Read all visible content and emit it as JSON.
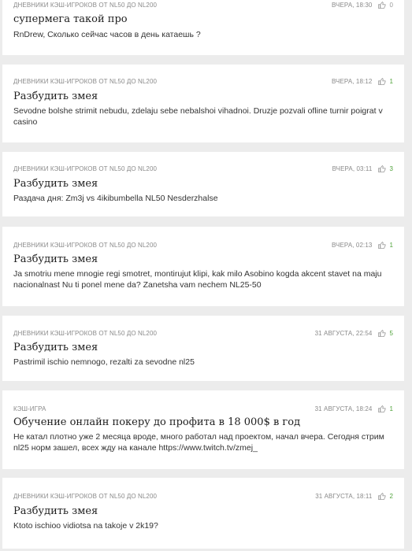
{
  "feed": {
    "posts": [
      {
        "category": "Дневники кэш-игроков от NL50 до NL200",
        "date": "Вчера, 18:30",
        "likes": "0",
        "title": "супермега такой про",
        "excerpt": "RnDrew, Сколько сейчас часов в день катаешь ?"
      },
      {
        "category": "Дневники кэш-игроков от NL50 до NL200",
        "date": "Вчера, 18:12",
        "likes": "1",
        "title": "Разбудить змея",
        "excerpt": "Sevodne bolshe strimit nebudu, zdelaju sebe nebalshoi vihadnoi. Druzje pozvali ofline turnir poigrat v casino"
      },
      {
        "category": "Дневники кэш-игроков от NL50 до NL200",
        "date": "Вчера, 03:11",
        "likes": "3",
        "title": "Разбудить змея",
        "excerpt": "Раздача дня: Zm3j vs 4ikibumbella NL50 Nesderzhalse"
      },
      {
        "category": "Дневники кэш-игроков от NL50 до NL200",
        "date": "Вчера, 02:13",
        "likes": "1",
        "title": "Разбудить змея",
        "excerpt": "Ja smotriu mene mnogie regi smotret, montirujut klipi, kak milo Asobino kogda akcent stavet na maju nacionalnast Nu ti ponel mene da? Zanetsha vam nechem NL25-50"
      },
      {
        "category": "Дневники кэш-игроков от NL50 до NL200",
        "date": "31 августа, 22:54",
        "likes": "5",
        "title": "Разбудить змея",
        "excerpt": "Pastrimil ischio nemnogo, rezalti za sevodne nl25"
      },
      {
        "category": "Кэш-игра",
        "date": "31 августа, 18:24",
        "likes": "1",
        "title": "Обучение онлайн покеру до профита в 18 000$ в год",
        "excerpt": "Не катал плотно уже 2 месяца вроде, много работал над проектом, начал вчера. Сегодня стрим nl25 норм зашел, всех жду на канале https://www.twitch.tv/zmej_"
      },
      {
        "category": "Дневники кэш-игроков от NL50 до NL200",
        "date": "31 августа, 18:11",
        "likes": "2",
        "title": "Разбудить змея",
        "excerpt": "Ktoto ischioo vidiotsa na takoje v 2k19?"
      }
    ]
  },
  "colors": {
    "page_background": "#ececec",
    "card_background": "#ffffff",
    "meta_text": "#8a8a8a",
    "like_count": "#4fa23a",
    "title_text": "#1e1e1e"
  },
  "icons": {
    "like": "thumbs-up-icon"
  }
}
